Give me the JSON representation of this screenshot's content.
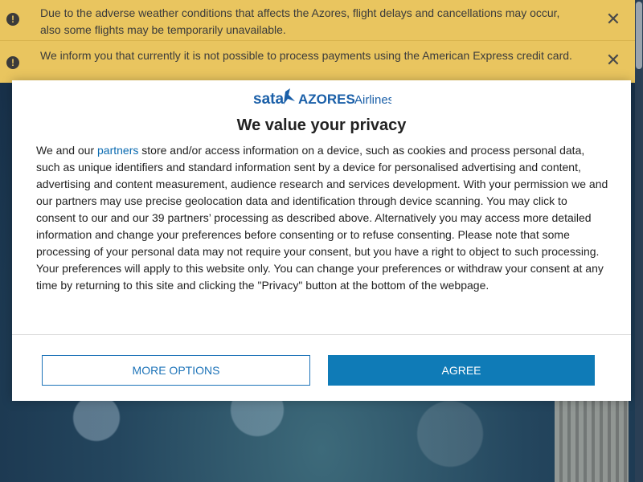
{
  "notices": [
    {
      "text": "Due to the adverse weather conditions that affects the Azores, flight delays and cancellations may occur, also some flights may be temporarily unavailable.",
      "icon": "exclamation-circle-icon",
      "close_glyph": "✕"
    },
    {
      "text": "We inform you that currently it is not possible to process payments using the American Express credit card.",
      "icon": "exclamation-circle-icon",
      "close_glyph": "✕"
    }
  ],
  "dialog": {
    "logo": {
      "brand_left": "sata",
      "brand_right": "AZORES",
      "suffix": "Airlines"
    },
    "title": "We value your privacy",
    "body_prefix": "We and our ",
    "partners_link": "partners",
    "body_rest": " store and/or access information on a device, such as cookies and process personal data, such as unique identifiers and standard information sent by a device for personalised advertising and content, advertising and content measurement, audience research and services development. With your permission we and our partners may use precise geolocation data and identification through device scanning. You may click to consent to our and our 39 partners’ processing as described above. Alternatively you may access more detailed information and change your preferences before consenting or to refuse consenting. Please note that some processing of your personal data may not require your consent, but you have a right to object to such processing. Your preferences will apply to this website only. You can change your preferences or withdraw your consent at any time by returning to this site and clicking the \"Privacy\" button at the bottom of the webpage.",
    "more_options_label": "MORE OPTIONS",
    "agree_label": "AGREE"
  },
  "colors": {
    "notice_bg": "#e9c55f",
    "link": "#0a6ab0",
    "primary": "#0f7bb7",
    "brand_blue": "#1a5fa8"
  }
}
